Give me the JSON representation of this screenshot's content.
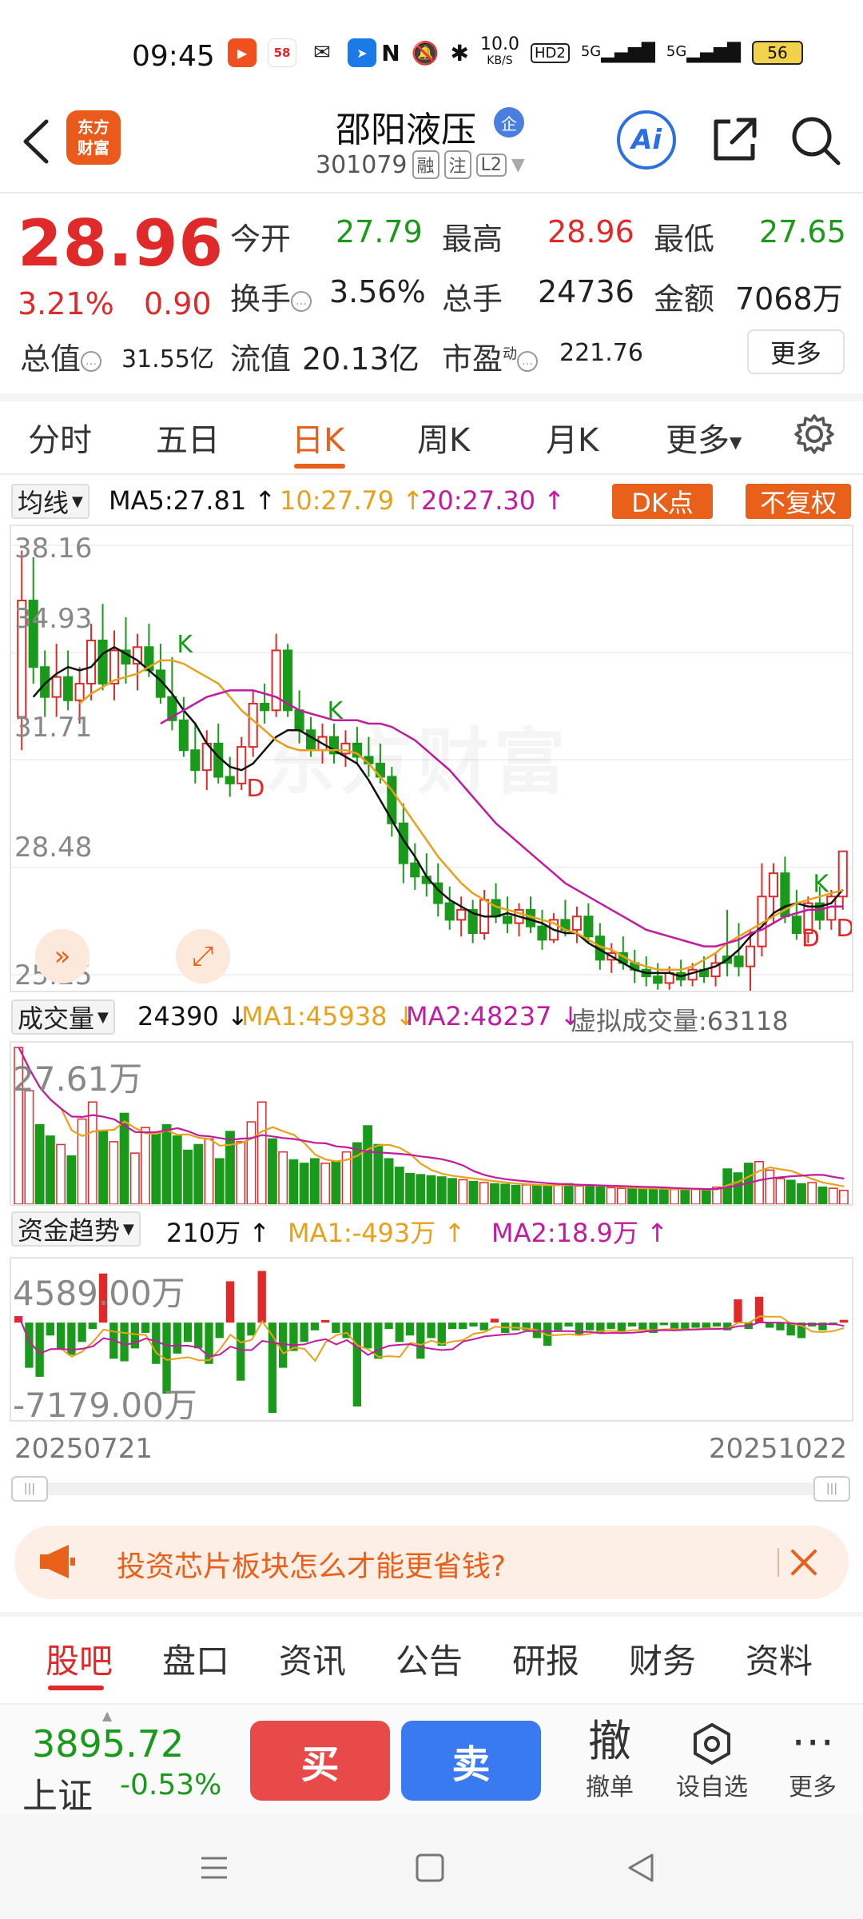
{
  "status_bar": {
    "time": "09:45",
    "app_icons": [
      "app-red-icon",
      "58-app-icon",
      "wechat-icon",
      "app-blue-icon"
    ],
    "net_speed_top": "10.0",
    "net_speed_unit": "KB/S",
    "hd_label": "HD2",
    "signal1": "5G",
    "signal2": "5G",
    "battery": "56"
  },
  "header": {
    "logo_line1": "东方",
    "logo_line2": "财富",
    "stock_name": "邵阳液压",
    "name_badge": "企",
    "stock_code": "301079",
    "tag_rong": "融",
    "tag_zhu": "注",
    "tag_l2": "L2",
    "ai_label": "Ai"
  },
  "quote": {
    "price": "28.96",
    "change_pct": "3.21%",
    "change_val": "0.90",
    "open_label": "今开",
    "open": "27.79",
    "high_label": "最高",
    "high": "28.96",
    "low_label": "最低",
    "low": "27.65",
    "turnover_label": "换手",
    "turnover": "3.56%",
    "volume_label": "总手",
    "volume": "24736",
    "amount_label": "金额",
    "amount": "7068万",
    "mktcap_label": "总值",
    "mktcap": "31.55亿",
    "float_label": "流值",
    "float_cap": "20.13亿",
    "pe_label": "市盈",
    "pe_sup": "动",
    "pe": "221.76",
    "more_label": "更多"
  },
  "tabs": {
    "t1": "分时",
    "t2": "五日",
    "t3": "日K",
    "t4": "周K",
    "t5": "月K",
    "t6": "更多"
  },
  "ma_legend": {
    "selector": "均线",
    "ma5": "MA5:27.81",
    "ma10": "10:27.79",
    "ma20": "20:27.30",
    "dk_label": "DK点",
    "fq_label": "不复权"
  },
  "kline_axis": {
    "y1": "38.16",
    "y2": "34.93",
    "y3": "31.71",
    "y4": "28.48",
    "y5": "25.25"
  },
  "volume_legend": {
    "selector": "成交量",
    "value": "24390",
    "ma1": "MA1:45938",
    "ma2": "MA2:48237",
    "virtual": "虚拟成交量:63118",
    "axis_top": "27.61万"
  },
  "fund_legend": {
    "selector": "资金趋势",
    "value": "210万",
    "ma1": "MA1:-493万",
    "ma2": "MA2:18.9万",
    "axis_top": "4589.00万",
    "axis_bottom": "-7179.00万"
  },
  "dates": {
    "start": "20250721",
    "end": "20251022"
  },
  "banner": {
    "text": "投资芯片板块怎么才能更省钱?"
  },
  "bottom_tabs": {
    "b1": "股吧",
    "b2": "盘口",
    "b3": "资讯",
    "b4": "公告",
    "b5": "研报",
    "b6": "财务",
    "b7": "资料"
  },
  "trade_bar": {
    "index_value": "3895.72",
    "index_name": "上证",
    "index_pct": "-0.53%",
    "buy": "买",
    "sell": "卖",
    "cancel_glyph": "撤",
    "cancel_label": "撤单",
    "watch_label": "设自选",
    "more_label": "更多"
  },
  "colors": {
    "up": "#e02a2a",
    "down": "#1a9a1a",
    "accent": "#e8601a",
    "ma5": "#111111",
    "ma10": "#e8a11a",
    "ma20": "#c21aa0"
  },
  "chart_data": {
    "type": "candlestick",
    "price_range": [
      25.25,
      38.16
    ],
    "ticks": [
      38.16,
      34.93,
      31.71,
      28.48,
      25.25
    ],
    "markers": [
      "K",
      "D"
    ],
    "candles": [
      [
        33.0,
        38.0,
        32.0,
        36.5,
        1
      ],
      [
        36.5,
        37.8,
        34.0,
        34.5,
        0
      ],
      [
        34.5,
        35.0,
        33.0,
        33.6,
        0
      ],
      [
        33.6,
        35.2,
        33.0,
        34.2,
        1
      ],
      [
        34.2,
        35.0,
        33.2,
        33.5,
        0
      ],
      [
        33.5,
        34.5,
        32.8,
        34.0,
        1
      ],
      [
        34.0,
        35.8,
        33.5,
        35.3,
        1
      ],
      [
        35.3,
        36.4,
        33.8,
        34.0,
        0
      ],
      [
        34.0,
        35.6,
        33.5,
        35.0,
        1
      ],
      [
        35.0,
        36.0,
        34.0,
        34.6,
        0
      ],
      [
        34.6,
        35.5,
        33.8,
        35.1,
        1
      ],
      [
        35.1,
        35.8,
        34.2,
        34.4,
        0
      ],
      [
        34.4,
        35.2,
        33.4,
        33.6,
        0
      ],
      [
        33.6,
        34.8,
        32.6,
        32.9,
        0
      ],
      [
        32.9,
        33.6,
        31.8,
        32.0,
        0
      ],
      [
        32.0,
        32.8,
        31.0,
        31.4,
        0
      ],
      [
        31.4,
        32.6,
        30.8,
        32.2,
        1
      ],
      [
        32.2,
        32.8,
        31.0,
        31.2,
        0
      ],
      [
        31.2,
        31.8,
        30.6,
        31.0,
        0
      ],
      [
        31.0,
        32.4,
        30.8,
        32.1,
        1
      ],
      [
        32.1,
        33.8,
        31.8,
        33.4,
        1
      ],
      [
        33.4,
        34.0,
        32.8,
        33.2,
        0
      ],
      [
        33.2,
        35.5,
        33.0,
        35.0,
        1
      ],
      [
        35.0,
        35.2,
        33.0,
        33.2,
        0
      ],
      [
        33.2,
        33.8,
        32.2,
        32.6,
        0
      ],
      [
        32.6,
        33.0,
        31.8,
        32.0,
        0
      ],
      [
        32.0,
        32.8,
        31.6,
        32.4,
        1
      ],
      [
        32.4,
        32.8,
        31.6,
        31.9,
        0
      ],
      [
        31.9,
        32.6,
        31.5,
        32.2,
        1
      ],
      [
        32.2,
        32.7,
        31.6,
        31.8,
        0
      ],
      [
        31.8,
        32.4,
        31.2,
        31.6,
        0
      ],
      [
        31.6,
        32.2,
        31.0,
        31.2,
        0
      ],
      [
        31.2,
        31.5,
        29.4,
        29.8,
        0
      ],
      [
        29.8,
        30.4,
        28.0,
        28.6,
        0
      ],
      [
        28.6,
        29.2,
        27.8,
        28.2,
        0
      ],
      [
        28.2,
        28.9,
        27.6,
        28.0,
        0
      ],
      [
        28.0,
        28.6,
        27.0,
        27.4,
        0
      ],
      [
        27.4,
        27.9,
        26.6,
        26.9,
        0
      ],
      [
        26.9,
        27.6,
        26.4,
        27.2,
        1
      ],
      [
        27.2,
        27.5,
        26.2,
        26.5,
        0
      ],
      [
        26.5,
        27.8,
        26.3,
        27.5,
        1
      ],
      [
        27.5,
        28.0,
        26.8,
        27.0,
        0
      ],
      [
        27.0,
        27.6,
        26.5,
        26.8,
        0
      ],
      [
        26.8,
        27.4,
        26.4,
        27.2,
        1
      ],
      [
        27.2,
        27.6,
        26.5,
        26.7,
        0
      ],
      [
        26.7,
        27.2,
        26.0,
        26.3,
        0
      ],
      [
        26.3,
        27.1,
        26.2,
        26.9,
        1
      ],
      [
        26.9,
        27.5,
        26.4,
        26.6,
        0
      ],
      [
        26.6,
        27.3,
        26.2,
        27.0,
        1
      ],
      [
        27.0,
        27.4,
        26.2,
        26.4,
        0
      ],
      [
        26.4,
        26.8,
        25.4,
        25.7,
        0
      ],
      [
        25.7,
        26.2,
        25.3,
        25.9,
        1
      ],
      [
        25.9,
        26.4,
        25.4,
        25.6,
        0
      ],
      [
        25.6,
        26.0,
        25.0,
        25.4,
        0
      ],
      [
        25.4,
        25.8,
        24.9,
        25.2,
        0
      ],
      [
        25.2,
        25.6,
        24.8,
        25.0,
        0
      ],
      [
        25.0,
        25.5,
        24.8,
        25.3,
        1
      ],
      [
        25.3,
        25.7,
        24.9,
        25.1,
        0
      ],
      [
        25.1,
        25.6,
        24.9,
        25.4,
        1
      ],
      [
        25.4,
        25.8,
        25.0,
        25.2,
        0
      ],
      [
        25.2,
        25.9,
        24.9,
        25.6,
        1
      ],
      [
        25.6,
        27.2,
        25.2,
        25.8,
        0
      ],
      [
        25.8,
        26.8,
        25.2,
        25.5,
        0
      ],
      [
        25.5,
        26.6,
        24.6,
        26.1,
        1
      ],
      [
        26.1,
        28.6,
        25.8,
        27.6,
        1
      ],
      [
        27.6,
        28.6,
        26.8,
        28.3,
        1
      ],
      [
        28.3,
        28.8,
        26.8,
        27.0,
        0
      ],
      [
        27.0,
        27.8,
        26.3,
        26.5,
        0
      ],
      [
        26.5,
        27.6,
        26.2,
        27.4,
        1
      ],
      [
        27.4,
        27.9,
        26.6,
        26.9,
        0
      ],
      [
        26.9,
        27.8,
        26.6,
        27.6,
        1
      ],
      [
        27.6,
        28.9,
        27.2,
        28.96,
        1
      ]
    ],
    "series": [
      {
        "name": "MA5",
        "values": [
          33.6,
          34.0,
          34.3,
          34.5,
          34.4,
          34.5,
          34.9,
          35.1,
          34.9,
          34.7,
          34.4,
          34.1,
          33.7,
          33.2,
          32.8,
          32.2,
          31.8,
          31.5,
          31.4,
          31.6,
          32.0,
          32.4,
          32.6,
          32.6,
          32.4,
          32.2,
          32.0,
          31.8,
          31.6,
          31.1,
          30.5,
          29.9,
          29.3,
          28.8,
          28.2,
          27.8,
          27.5,
          27.3,
          27.1,
          27.0,
          27.0,
          27.1,
          27.0,
          26.9,
          26.8,
          26.6,
          26.5,
          26.5,
          26.2,
          26.0,
          25.8,
          25.6,
          25.4,
          25.3,
          25.3,
          25.3,
          25.2,
          25.3,
          25.4,
          25.5,
          25.7,
          26.0,
          26.4,
          26.7,
          27.1,
          27.3,
          27.4,
          27.3,
          27.3,
          27.4,
          27.81
        ]
      },
      {
        "name": "MA10",
        "values": [
          33.4,
          33.7,
          33.9,
          34.1,
          34.2,
          34.3,
          34.5,
          34.7,
          34.7,
          34.6,
          34.4,
          34.2,
          34.0,
          33.6,
          33.2,
          32.9,
          32.6,
          32.3,
          32.1,
          32.0,
          32.0,
          32.0,
          32.0,
          32.0,
          31.9,
          31.6,
          31.2,
          30.8,
          30.3,
          29.8,
          29.3,
          28.8,
          28.4,
          28.0,
          27.7,
          27.5,
          27.3,
          27.2,
          27.1,
          27.0,
          26.9,
          26.8,
          26.6,
          26.5,
          26.3,
          26.1,
          26.0,
          25.8,
          25.6,
          25.5,
          25.4,
          25.4,
          25.4,
          25.5,
          25.7,
          25.9,
          26.2,
          26.4,
          26.6,
          26.8,
          27.0,
          27.2,
          27.4,
          27.5,
          27.6,
          27.7,
          27.79
        ]
      },
      {
        "name": "MA20",
        "values": [
          32.8,
          33.0,
          33.2,
          33.4,
          33.6,
          33.7,
          33.8,
          33.8,
          33.8,
          33.7,
          33.6,
          33.4,
          33.2,
          33.1,
          33.0,
          32.9,
          32.9,
          32.9,
          32.8,
          32.8,
          32.7,
          32.5,
          32.3,
          32.0,
          31.7,
          31.4,
          31.0,
          30.6,
          30.2,
          29.8,
          29.5,
          29.2,
          28.9,
          28.6,
          28.3,
          28.0,
          27.8,
          27.6,
          27.4,
          27.2,
          27.0,
          26.8,
          26.6,
          26.5,
          26.4,
          26.3,
          26.2,
          26.1,
          26.1,
          26.2,
          26.3,
          26.5,
          26.6,
          26.8,
          27.0,
          27.1,
          27.2,
          27.2,
          27.3,
          27.3
        ]
      }
    ],
    "volume": {
      "range": [
        0,
        276100
      ],
      "values": [
        276100,
        200000,
        140000,
        120000,
        105000,
        85000,
        150000,
        180000,
        130000,
        110000,
        160000,
        90000,
        135000,
        125000,
        140000,
        120000,
        95000,
        105000,
        115000,
        80000,
        128000,
        110000,
        145000,
        180000,
        115000,
        92000,
        78000,
        72000,
        80000,
        72000,
        75000,
        92000,
        108000,
        138000,
        105000,
        80000,
        65000,
        54000,
        52000,
        50000,
        48000,
        45000,
        43000,
        40000,
        38000,
        36000,
        35000,
        33000,
        34000,
        32000,
        33000,
        34000,
        36000,
        32000,
        31000,
        30000,
        29000,
        28000,
        27000,
        26000,
        28000,
        27000,
        26000,
        25000,
        26000,
        24000,
        30000,
        62000,
        55000,
        72000,
        75000,
        60000,
        45000,
        42000,
        36000,
        38000,
        30000,
        28000,
        24390
      ]
    },
    "fund_flow": {
      "range": [
        -71790000,
        45890000
      ],
      "values": [
        5000000,
        -35000000,
        -42000000,
        -10000000,
        -20000000,
        -25000000,
        -15000000,
        -5000000,
        38000000,
        -28000000,
        -30000000,
        -20000000,
        -8000000,
        -32000000,
        -55000000,
        -24000000,
        -15000000,
        -20000000,
        -32000000,
        -12000000,
        32000000,
        -45000000,
        -10000000,
        40000000,
        -70000000,
        -35000000,
        -22000000,
        -15000000,
        -6000000,
        2000000,
        -8000000,
        -12000000,
        -65000000,
        -20000000,
        -28000000,
        -5000000,
        -15000000,
        -10000000,
        -28000000,
        -12000000,
        -18000000,
        -5000000,
        -5000000,
        -3000000,
        -6000000,
        3000000,
        -8000000,
        -6000000,
        -6000000,
        -12000000,
        -18000000,
        -6000000,
        -3000000,
        -10000000,
        -6000000,
        -8000000,
        -5000000,
        -7000000,
        -3000000,
        -6000000,
        -8000000,
        -2000000,
        -6000000,
        -5000000,
        -4000000,
        -5000000,
        -3000000,
        -6000000,
        18000000,
        -5000000,
        20000000,
        -4000000,
        -6000000,
        -10000000,
        -12000000,
        -3000000,
        -6000000,
        -2000000,
        2100000
      ]
    }
  }
}
